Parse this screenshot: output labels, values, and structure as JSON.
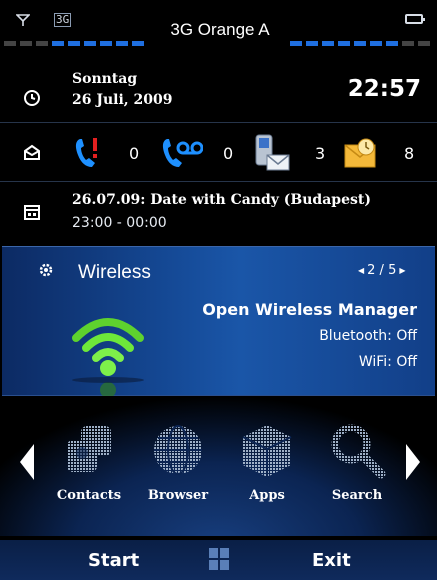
{
  "status_bar": {
    "operator": "3G Orange A",
    "network_type": "3G",
    "icons": [
      "signal-antenna-icon",
      "3g-icon",
      "battery-icon"
    ]
  },
  "clock": {
    "day": "Sonntag",
    "date": "26 Juli, 2009",
    "time": "22:57"
  },
  "notifications": [
    {
      "icon": "missed-call-icon",
      "count": "0"
    },
    {
      "icon": "voicemail-icon",
      "count": "0"
    },
    {
      "icon": "sms-icon",
      "count": "3"
    },
    {
      "icon": "email-icon",
      "count": "8"
    }
  ],
  "appointment": {
    "title": "26.07.09: Date with Candy (Budapest)",
    "time": "23:00 - 00:00"
  },
  "wireless_panel": {
    "title": "Wireless",
    "pager": "2 / 5",
    "action": "Open Wireless Manager",
    "bluetooth": "Bluetooth: Off",
    "wifi": "WiFi: Off"
  },
  "launcher": {
    "apps": [
      {
        "label": "Contacts",
        "icon": "contacts-icon"
      },
      {
        "label": "Browser",
        "icon": "globe-icon"
      },
      {
        "label": "Apps",
        "icon": "cube-icon"
      },
      {
        "label": "Search",
        "icon": "magnifier-icon"
      }
    ]
  },
  "softkeys": {
    "left": "Start",
    "right": "Exit"
  },
  "colors": {
    "accent_blue": "#1a56a8",
    "status_dash": "#1f6fe0",
    "wifi_green": "#6ee83a",
    "call_red": "#e32020"
  }
}
